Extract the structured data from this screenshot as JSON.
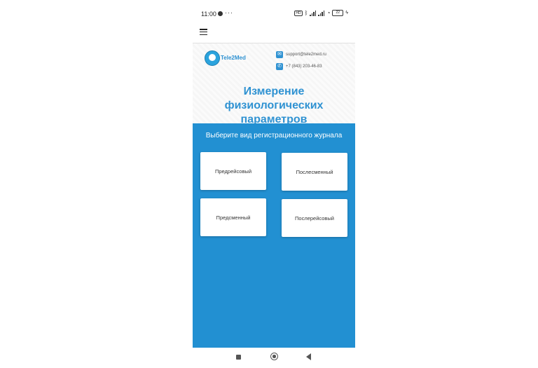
{
  "status_bar": {
    "time": "11:00",
    "dots": "···",
    "battery": "22"
  },
  "header": {
    "menu_icon": "hamburger-icon"
  },
  "hero": {
    "brand": "Tele2Med",
    "email": "support@tele2med.ru",
    "phone": "+7 (843) 203-46-83",
    "title_line1": "Измерение физиологических",
    "title_line2": "параметров"
  },
  "journal": {
    "prompt": "Выберите вид регистрационного журнала",
    "options": [
      "Предрейсовый",
      "Послесменный",
      "Предсменный",
      "Послерейсовый"
    ]
  },
  "colors": {
    "accent": "#2290d2",
    "title": "#2f92d2"
  },
  "nav_bar": {
    "icons": [
      "recents-icon",
      "home-icon",
      "back-icon"
    ]
  }
}
